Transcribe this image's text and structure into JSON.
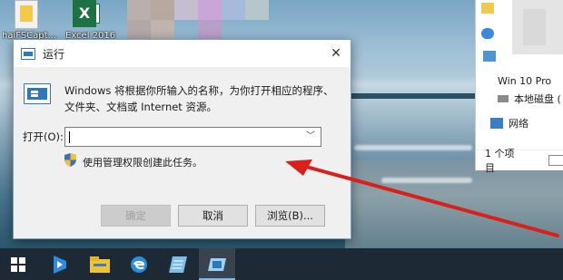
{
  "desktop": {
    "icons": [
      {
        "label": "haiFSCapt..."
      },
      {
        "label": "Excel 2016"
      }
    ]
  },
  "explorer": {
    "items": [
      "Win 10 Pro",
      "本地磁盘 (",
      "网络"
    ],
    "status": {
      "count": "1 个项目"
    },
    "icons": [
      "folder-icon",
      "cloud-icon",
      "computer-icon",
      "drive-icon",
      "network-icon"
    ]
  },
  "dialog": {
    "title": "运行",
    "description": "Windows 将根据你所输入的名称，为你打开相应的程序、文件夹、文档或 Internet 资源。",
    "open_label": "打开(O):",
    "open_value": "",
    "shield_text": "使用管理权限创建此任务。",
    "buttons": {
      "ok": "确定",
      "cancel": "取消",
      "browse": "浏览(B)..."
    }
  },
  "taskbar": {
    "items": [
      "start-icon",
      "mail-app-icon",
      "file-explorer-icon",
      "edge-icon",
      "notepad-icon",
      "run-icon"
    ]
  },
  "colors": {
    "accent": "#2f78b8",
    "annotation_arrow": "#d9201a",
    "taskbar": "#1d2a36"
  }
}
